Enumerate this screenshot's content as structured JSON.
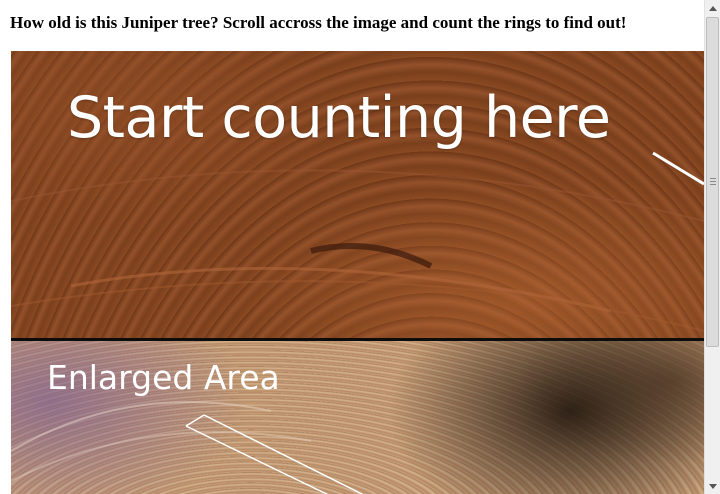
{
  "page": {
    "title": "How old is this Juniper tree? Scroll accross the image and count the rings to find out!"
  },
  "image": {
    "top_panel_label": "Start counting here",
    "bottom_panel_label": "Enlarged Area"
  },
  "scrollbar": {
    "up_icon": "arrow-up-icon",
    "down_icon": "arrow-down-icon"
  }
}
